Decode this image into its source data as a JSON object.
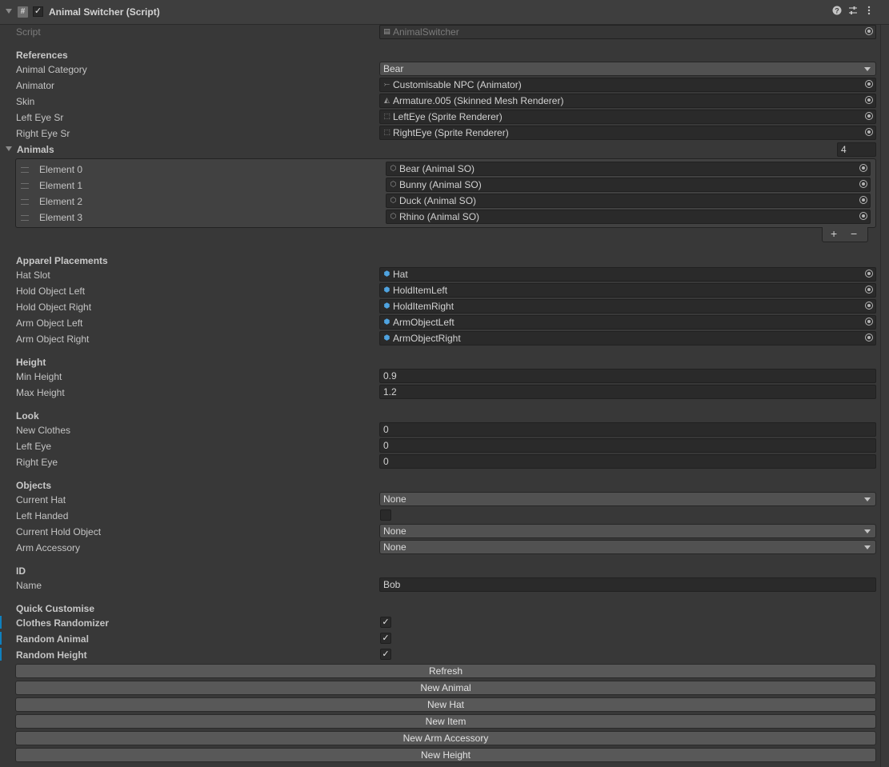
{
  "header": {
    "title": "Animal Switcher (Script)",
    "enabled": true,
    "help_icon": "help-icon",
    "presets_icon": "presets-icon",
    "menu_icon": "kebab-menu-icon"
  },
  "script": {
    "label": "Script",
    "value": "AnimalSwitcher"
  },
  "references": {
    "section": "References",
    "animal_category": {
      "label": "Animal Category",
      "value": "Bear"
    },
    "animator": {
      "label": "Animator",
      "value": "Customisable NPC (Animator)"
    },
    "skin": {
      "label": "Skin",
      "value": "Armature.005 (Skinned Mesh Renderer)"
    },
    "left_eye": {
      "label": "Left Eye Sr",
      "value": "LeftEye (Sprite Renderer)"
    },
    "right_eye": {
      "label": "Right Eye Sr",
      "value": "RightEye (Sprite Renderer)"
    }
  },
  "animals": {
    "label": "Animals",
    "size": "4",
    "elements": [
      {
        "label": "Element 0",
        "value": "Bear (Animal SO)"
      },
      {
        "label": "Element 1",
        "value": "Bunny (Animal SO)"
      },
      {
        "label": "Element 2",
        "value": "Duck (Animal SO)"
      },
      {
        "label": "Element 3",
        "value": "Rhino (Animal SO)"
      }
    ],
    "add": "+",
    "remove": "−"
  },
  "apparel": {
    "section": "Apparel Placements",
    "items": [
      {
        "label": "Hat Slot",
        "value": "Hat"
      },
      {
        "label": "Hold Object Left",
        "value": "HoldItemLeft"
      },
      {
        "label": "Hold Object Right",
        "value": "HoldItemRight"
      },
      {
        "label": "Arm Object Left",
        "value": "ArmObjectLeft"
      },
      {
        "label": "Arm Object Right",
        "value": "ArmObjectRight"
      }
    ]
  },
  "height": {
    "section": "Height",
    "min": {
      "label": "Min Height",
      "value": "0.9"
    },
    "max": {
      "label": "Max Height",
      "value": "1.2"
    }
  },
  "look": {
    "section": "Look",
    "new_clothes": {
      "label": "New Clothes",
      "value": "0"
    },
    "left_eye": {
      "label": "Left Eye",
      "value": "0"
    },
    "right_eye": {
      "label": "Right Eye",
      "value": "0"
    }
  },
  "objects": {
    "section": "Objects",
    "current_hat": {
      "label": "Current Hat",
      "value": "None"
    },
    "left_handed": {
      "label": "Left Handed",
      "checked": false
    },
    "current_hold": {
      "label": "Current Hold Object",
      "value": "None"
    },
    "arm_accessory": {
      "label": "Arm Accessory",
      "value": "None"
    }
  },
  "id": {
    "section": "ID",
    "name": {
      "label": "Name",
      "value": "Bob"
    }
  },
  "quick": {
    "section": "Quick Customise",
    "clothes_randomizer": {
      "label": "Clothes Randomizer",
      "checked": true
    },
    "random_animal": {
      "label": "Random Animal",
      "checked": true
    },
    "random_height": {
      "label": "Random Height",
      "checked": true
    }
  },
  "buttons": {
    "refresh": "Refresh",
    "new_animal": "New Animal",
    "new_hat": "New Hat",
    "new_item": "New Item",
    "new_arm_accessory": "New Arm Accessory",
    "new_height": "New Height"
  },
  "check_glyph": "✓",
  "colors": {
    "accent": "#0f80be",
    "background": "#383838",
    "field": "#2a2a2a",
    "button": "#585858",
    "cube_icon": "#4fa3e0"
  }
}
